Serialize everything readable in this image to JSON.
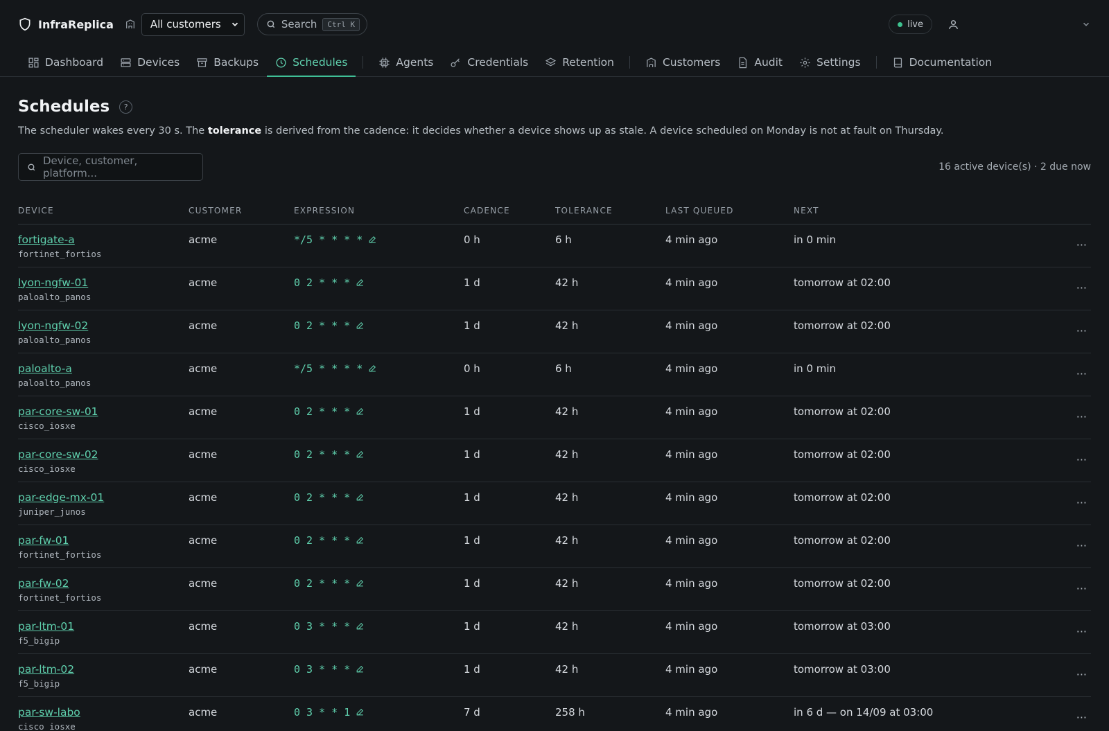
{
  "app": {
    "name": "InfraReplica",
    "customer_select": "All customers",
    "search_label": "Search",
    "search_shortcut": "Ctrl K",
    "live_label": "live"
  },
  "nav": [
    {
      "label": "Dashboard",
      "icon": "grid-icon"
    },
    {
      "label": "Devices",
      "icon": "server-icon"
    },
    {
      "label": "Backups",
      "icon": "archive-icon"
    },
    {
      "label": "Schedules",
      "icon": "clock-icon",
      "active": true
    },
    {
      "label": "Agents",
      "icon": "cpu-icon"
    },
    {
      "label": "Credentials",
      "icon": "key-icon"
    },
    {
      "label": "Retention",
      "icon": "layers-icon"
    },
    {
      "label": "Customers",
      "icon": "building-icon"
    },
    {
      "label": "Audit",
      "icon": "file-icon"
    },
    {
      "label": "Settings",
      "icon": "gear-icon"
    },
    {
      "label": "Documentation",
      "icon": "book-icon"
    }
  ],
  "page": {
    "title": "Schedules",
    "help": "?",
    "desc_pre": "The scheduler wakes every 30 s. The ",
    "desc_bold": "tolerance",
    "desc_post": " is derived from the cadence: it decides whether a device shows up as stale. A device scheduled on Monday is not at fault on Thursday.",
    "filter_placeholder": "Device, customer, platform...",
    "count": "16 active device(s) · 2 due now"
  },
  "table": {
    "headers": [
      "DEVICE",
      "CUSTOMER",
      "EXPRESSION",
      "CADENCE",
      "TOLERANCE",
      "LAST QUEUED",
      "NEXT"
    ],
    "more_label": "···",
    "rows": [
      {
        "device": "fortigate-a",
        "platform": "fortinet_fortios",
        "customer": "acme",
        "expression": "*/5 * * * *",
        "cadence": "0 h",
        "tolerance": "6 h",
        "last": "4 min ago",
        "next": "in 0 min"
      },
      {
        "device": "lyon-ngfw-01",
        "platform": "paloalto_panos",
        "customer": "acme",
        "expression": "0 2 * * *",
        "cadence": "1 d",
        "tolerance": "42 h",
        "last": "4 min ago",
        "next": "tomorrow at 02:00"
      },
      {
        "device": "lyon-ngfw-02",
        "platform": "paloalto_panos",
        "customer": "acme",
        "expression": "0 2 * * *",
        "cadence": "1 d",
        "tolerance": "42 h",
        "last": "4 min ago",
        "next": "tomorrow at 02:00"
      },
      {
        "device": "paloalto-a",
        "platform": "paloalto_panos",
        "customer": "acme",
        "expression": "*/5 * * * *",
        "cadence": "0 h",
        "tolerance": "6 h",
        "last": "4 min ago",
        "next": "in 0 min"
      },
      {
        "device": "par-core-sw-01",
        "platform": "cisco_iosxe",
        "customer": "acme",
        "expression": "0 2 * * *",
        "cadence": "1 d",
        "tolerance": "42 h",
        "last": "4 min ago",
        "next": "tomorrow at 02:00"
      },
      {
        "device": "par-core-sw-02",
        "platform": "cisco_iosxe",
        "customer": "acme",
        "expression": "0 2 * * *",
        "cadence": "1 d",
        "tolerance": "42 h",
        "last": "4 min ago",
        "next": "tomorrow at 02:00"
      },
      {
        "device": "par-edge-mx-01",
        "platform": "juniper_junos",
        "customer": "acme",
        "expression": "0 2 * * *",
        "cadence": "1 d",
        "tolerance": "42 h",
        "last": "4 min ago",
        "next": "tomorrow at 02:00"
      },
      {
        "device": "par-fw-01",
        "platform": "fortinet_fortios",
        "customer": "acme",
        "expression": "0 2 * * *",
        "cadence": "1 d",
        "tolerance": "42 h",
        "last": "4 min ago",
        "next": "tomorrow at 02:00"
      },
      {
        "device": "par-fw-02",
        "platform": "fortinet_fortios",
        "customer": "acme",
        "expression": "0 2 * * *",
        "cadence": "1 d",
        "tolerance": "42 h",
        "last": "4 min ago",
        "next": "tomorrow at 02:00"
      },
      {
        "device": "par-ltm-01",
        "platform": "f5_bigip",
        "customer": "acme",
        "expression": "0 3 * * *",
        "cadence": "1 d",
        "tolerance": "42 h",
        "last": "4 min ago",
        "next": "tomorrow at 03:00"
      },
      {
        "device": "par-ltm-02",
        "platform": "f5_bigip",
        "customer": "acme",
        "expression": "0 3 * * *",
        "cadence": "1 d",
        "tolerance": "42 h",
        "last": "4 min ago",
        "next": "tomorrow at 03:00"
      },
      {
        "device": "par-sw-labo",
        "platform": "cisco_iosxe",
        "customer": "acme",
        "expression": "0 3 * * 1",
        "cadence": "7 d",
        "tolerance": "258 h",
        "last": "4 min ago",
        "next": "in 6 d — on 14/09 at 03:00"
      }
    ]
  },
  "colors": {
    "accent": "#5fd0ad",
    "background": "#14171a",
    "live": "#3ec28f"
  }
}
